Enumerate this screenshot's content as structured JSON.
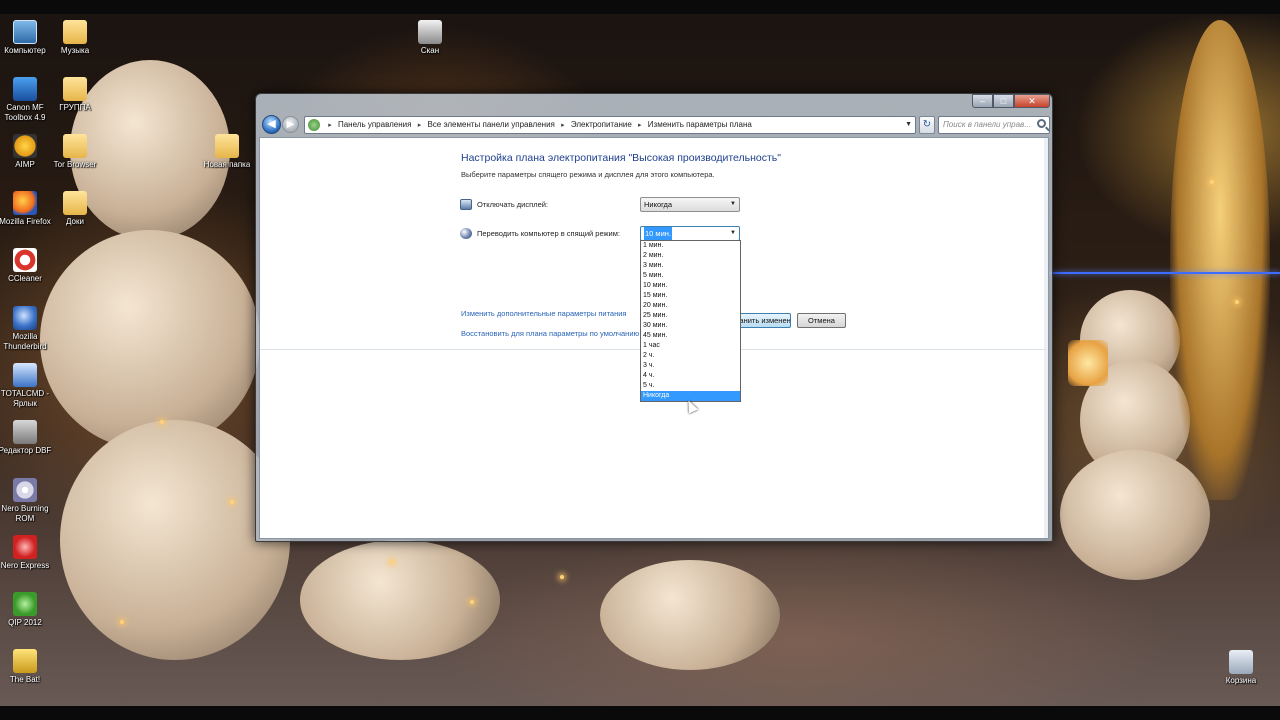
{
  "desktop": {
    "icons": [
      {
        "label": "Компьютер",
        "icon": "computer-icon"
      },
      {
        "label": "Музыка",
        "icon": "folder-icon"
      },
      {
        "label": "Canon MF Toolbox 4.9",
        "icon": "canon-icon"
      },
      {
        "label": "ГРУППА",
        "icon": "folder-icon"
      },
      {
        "label": "AIMP",
        "icon": "aimp-icon"
      },
      {
        "label": "Tor Browser",
        "icon": "folder-icon"
      },
      {
        "label": "Новая папка",
        "icon": "folder-icon"
      },
      {
        "label": "Mozilla Firefox",
        "icon": "firefox-icon"
      },
      {
        "label": "Доки",
        "icon": "folder-icon"
      },
      {
        "label": "CCleaner",
        "icon": "ccleaner-icon"
      },
      {
        "label": "Mozilla Thunderbird",
        "icon": "thunderbird-icon"
      },
      {
        "label": "TOTALCMD - Ярлык",
        "icon": "totalcmd-icon"
      },
      {
        "label": "Редактор DBF",
        "icon": "dbf-editor-icon"
      },
      {
        "label": "Nero Burning ROM",
        "icon": "nero-icon"
      },
      {
        "label": "Nero Express",
        "icon": "nero-express-icon"
      },
      {
        "label": "QIP 2012",
        "icon": "qip-icon"
      },
      {
        "label": "The Bat!",
        "icon": "thebat-icon"
      },
      {
        "label": "Скан",
        "icon": "printer-icon"
      },
      {
        "label": "Корзина",
        "icon": "recycle-bin-icon"
      }
    ]
  },
  "window": {
    "caption": {
      "minimize": "–",
      "maximize": "□",
      "close": "✕"
    },
    "breadcrumb": [
      "Панель управления",
      "Все элементы панели управления",
      "Электропитание",
      "Изменить параметры плана"
    ],
    "search_placeholder": "Поиск в панели управ...",
    "title": "Настройка плана электропитания \"Высокая производительность\"",
    "subtitle": "Выберите параметры спящего режима и дисплея для этого компьютера.",
    "display_off": {
      "label": "Отключать дисплей:",
      "value": "Никогда"
    },
    "sleep": {
      "label": "Переводить компьютер в спящий режим:",
      "value": "10 мин."
    },
    "links": {
      "advanced": "Изменить дополнительные параметры питания",
      "restore": "Восстановить для плана параметры по умолчанию"
    },
    "buttons": {
      "save": "Сохранить изменения",
      "cancel": "Отмена"
    },
    "dropdown": {
      "options": [
        "1 мин.",
        "2 мин.",
        "3 мин.",
        "5 мин.",
        "10 мин.",
        "15 мин.",
        "20 мин.",
        "25 мин.",
        "30 мин.",
        "45 мин.",
        "1 час",
        "2 ч.",
        "3 ч.",
        "4 ч.",
        "5 ч.",
        "Никогда"
      ],
      "highlighted": "Никогда"
    }
  }
}
